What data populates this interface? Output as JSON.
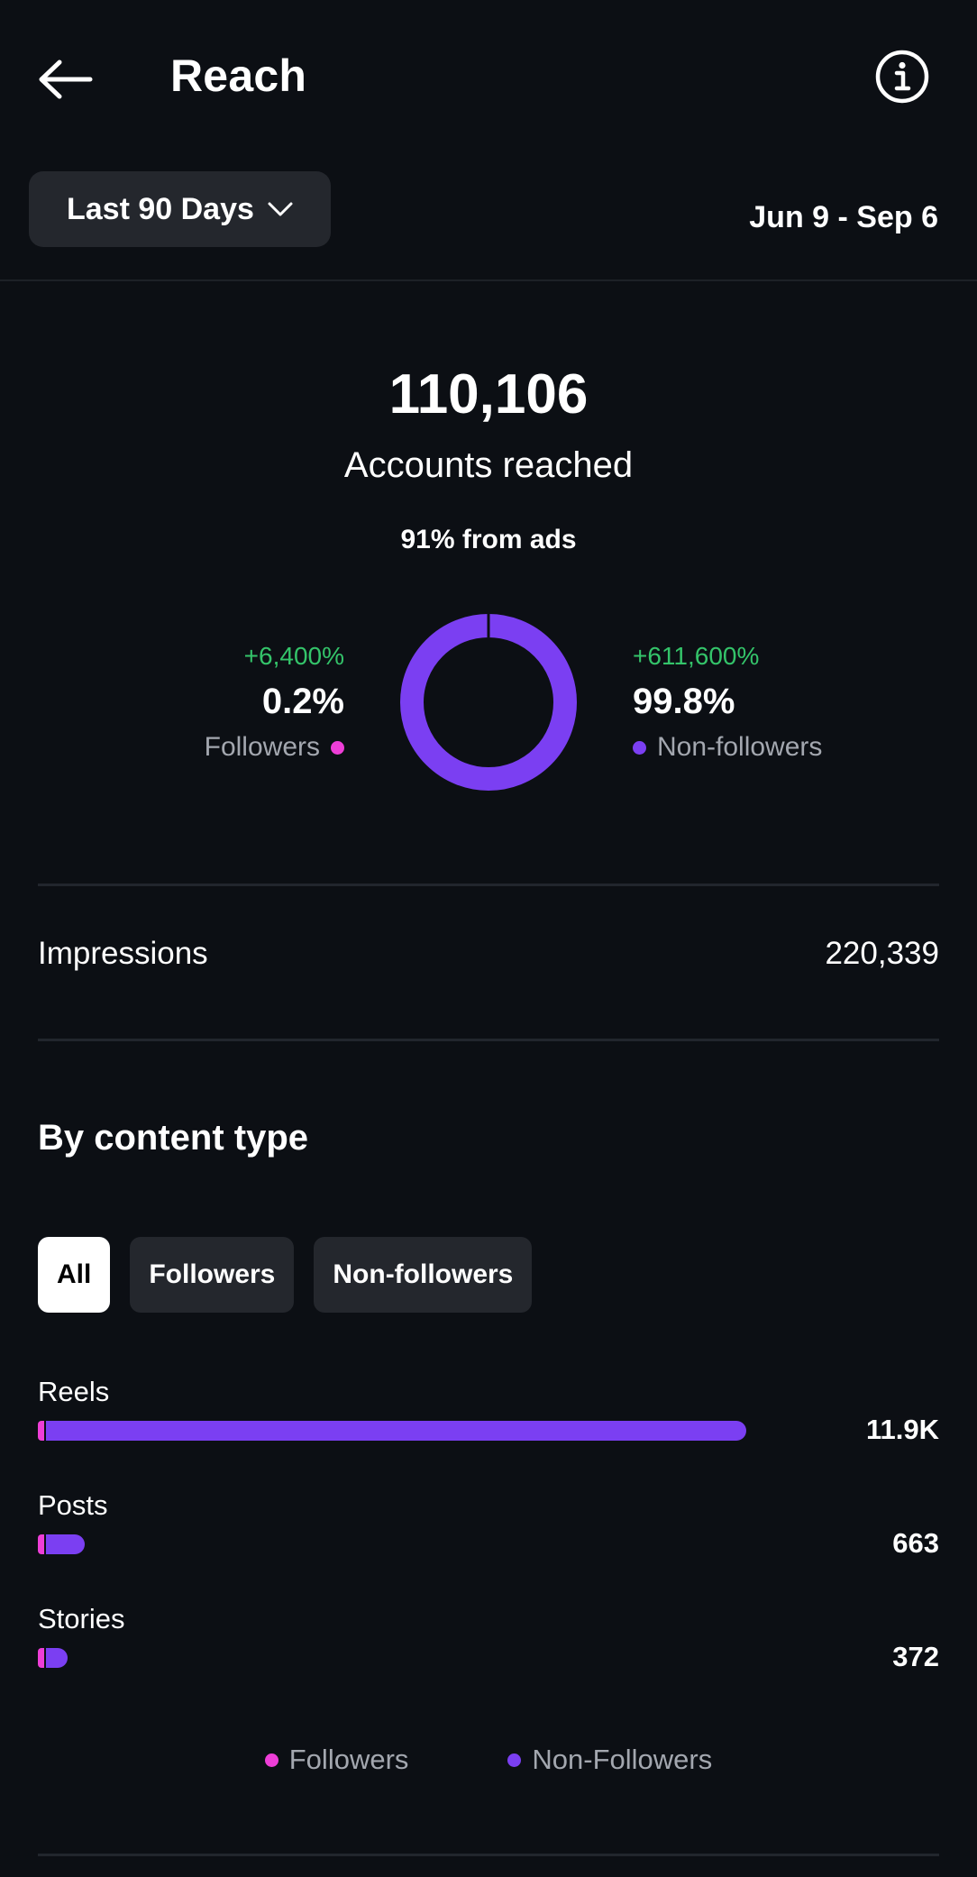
{
  "header": {
    "title": "Reach",
    "back_icon": "arrow-left-icon",
    "info_icon": "info-circle-icon"
  },
  "filter": {
    "range_label": "Last 90 Days",
    "date_range": "Jun 9 - Sep 6"
  },
  "summary": {
    "total": "110,106",
    "total_label": "Accounts reached",
    "ads_note": "91% from ads"
  },
  "audience": {
    "followers": {
      "change": "+6,400%",
      "percent": "0.2%",
      "label": "Followers",
      "share": 0.002
    },
    "non_followers": {
      "change": "+611,600%",
      "percent": "99.8%",
      "label": "Non-followers",
      "share": 0.998
    }
  },
  "impressions": {
    "label": "Impressions",
    "value": "220,339"
  },
  "content_type": {
    "title": "By content type",
    "tabs": [
      {
        "label": "All",
        "active": true
      },
      {
        "label": "Followers",
        "active": false
      },
      {
        "label": "Non-followers",
        "active": false
      }
    ],
    "rows": [
      {
        "label": "Reels",
        "value": "11.9K",
        "total": 11900
      },
      {
        "label": "Posts",
        "value": "663",
        "total": 663
      },
      {
        "label": "Stories",
        "value": "372",
        "total": 372
      }
    ],
    "legend": [
      {
        "label": "Followers"
      },
      {
        "label": "Non-Followers"
      }
    ]
  },
  "colors": {
    "followers": "#ee3ed7",
    "non_followers": "#7b3ff2",
    "positive": "#34c46a",
    "background": "#0c0f14"
  }
}
